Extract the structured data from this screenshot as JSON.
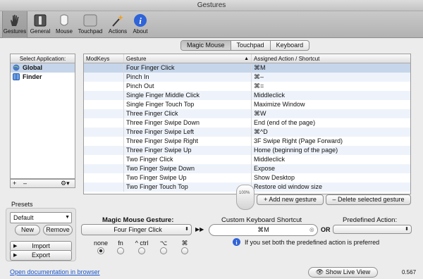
{
  "window": {
    "title": "Gestures"
  },
  "toolbar": {
    "items": [
      {
        "label": "Gestures",
        "icon": "hand-icon"
      },
      {
        "label": "General",
        "icon": "switch-icon"
      },
      {
        "label": "Mouse",
        "icon": "mouse-icon"
      },
      {
        "label": "Touchpad",
        "icon": "touchpad-icon"
      },
      {
        "label": "Actions",
        "icon": "wand-icon"
      },
      {
        "label": "About",
        "icon": "info-icon"
      }
    ]
  },
  "tabs": [
    "Magic Mouse",
    "Touchpad",
    "Keyboard"
  ],
  "apps": {
    "header": "Select Application:",
    "items": [
      "Global",
      "Finder"
    ]
  },
  "table": {
    "headers": [
      "ModKeys",
      "Gesture",
      "Assigned Action / Shortcut"
    ],
    "rows": [
      {
        "mod": "",
        "gesture": "Four Finger Click",
        "action": "⌘M"
      },
      {
        "mod": "",
        "gesture": "Pinch In",
        "action": "⌘–"
      },
      {
        "mod": "",
        "gesture": "Pinch Out",
        "action": "⌘="
      },
      {
        "mod": "",
        "gesture": "Single Finger Middle Click",
        "action": "Middleclick"
      },
      {
        "mod": "",
        "gesture": "Single Finger Touch Top",
        "action": "Maximize Window"
      },
      {
        "mod": "",
        "gesture": "Three Finger Click",
        "action": "⌘W"
      },
      {
        "mod": "",
        "gesture": "Three Finger Swipe Down",
        "action": "End (end of the page)"
      },
      {
        "mod": "",
        "gesture": "Three Finger Swipe Left",
        "action": "⌘^D"
      },
      {
        "mod": "",
        "gesture": "Three Finger Swipe Right",
        "action": "3F Swipe Right (Page Forward)"
      },
      {
        "mod": "",
        "gesture": "Three Finger Swipe Up",
        "action": "Home (beginning of the page)"
      },
      {
        "mod": "",
        "gesture": "Two Finger Click",
        "action": "Middleclick"
      },
      {
        "mod": "",
        "gesture": "Two Finger Swipe Down",
        "action": "Expose"
      },
      {
        "mod": "",
        "gesture": "Two Finger Swipe Up",
        "action": "Show Desktop"
      },
      {
        "mod": "",
        "gesture": "Two Finger Touch Top",
        "action": "Restore old window size"
      }
    ]
  },
  "mouse_zoom": "100%",
  "buttons": {
    "add_gesture": "+ Add new gesture",
    "delete_gesture": "– Delete selected gesture",
    "plus": "+",
    "minus": "–",
    "new": "New",
    "remove": "Remove",
    "import": "Import",
    "export": "Export",
    "live_view": "Show Live View"
  },
  "presets": {
    "label": "Presets",
    "selected": "Default"
  },
  "editor": {
    "gesture_label": "Magic Mouse Gesture:",
    "gesture_value": "Four Finger Click",
    "arrows": "▶▶",
    "shortcut_label": "Custom Keyboard Shortcut",
    "shortcut_value": "⌘M",
    "or_label": "OR",
    "predefined_label": "Predefined Action:",
    "predefined_value": "",
    "note": "If you set both the predefined action is preferred"
  },
  "modkeys": [
    "none",
    "fn",
    "^ ctrl",
    "⌥",
    "⌘"
  ],
  "footer": {
    "doc_link": "Open documentation in browser",
    "version": "0.567"
  },
  "colors": {
    "selection": "#c6d5ea",
    "stripe": "#eef3fb",
    "about_icon": "#2f63d8"
  }
}
